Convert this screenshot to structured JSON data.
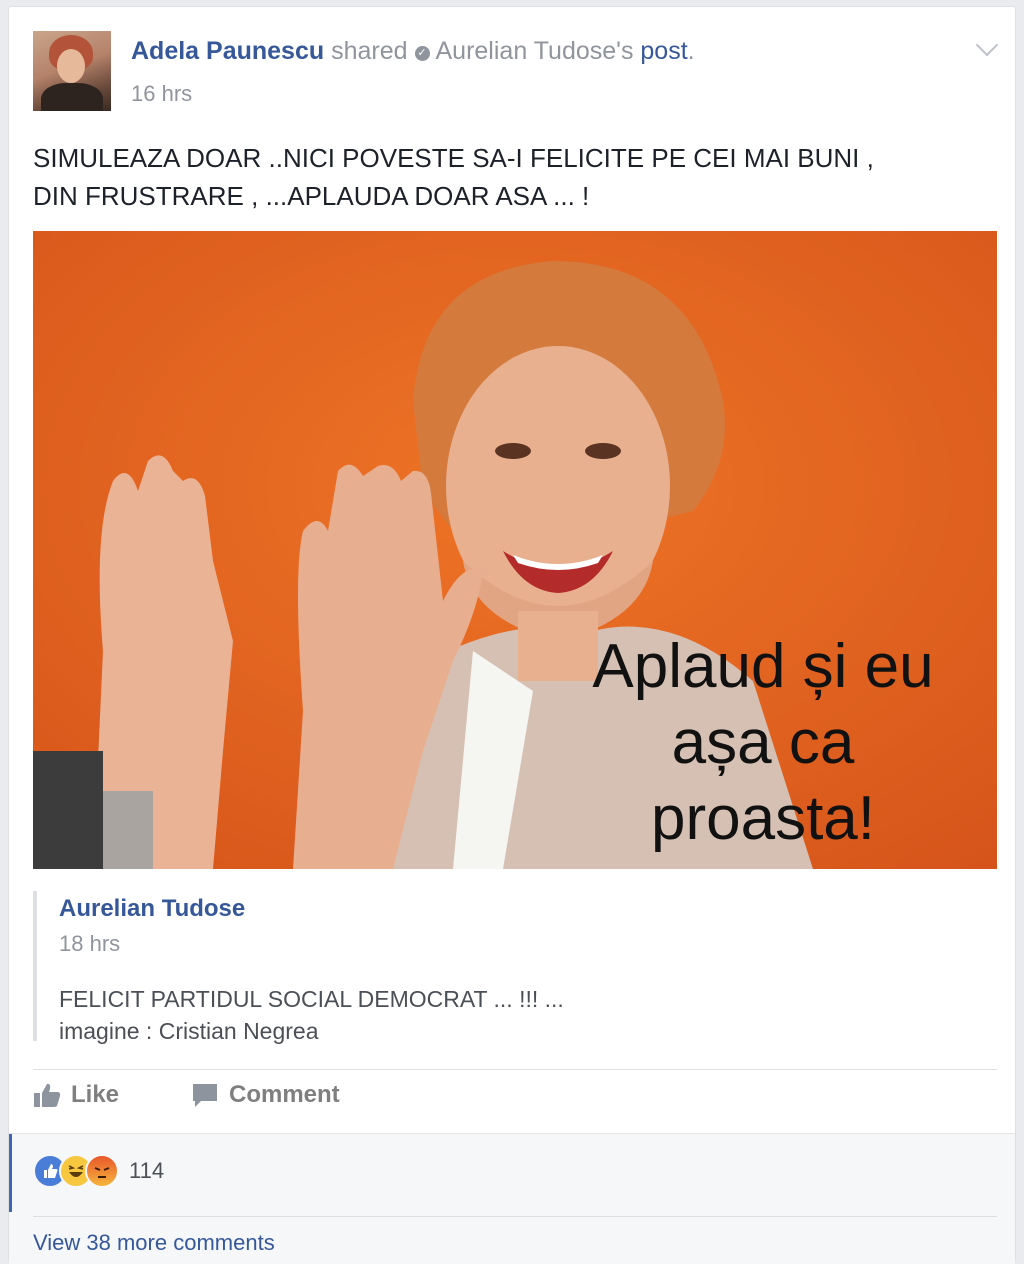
{
  "post": {
    "author": "Adela Paunescu",
    "shared_word": "shared",
    "shared_from": "Aurelian Tudose's",
    "post_word": "post",
    "time": "16 hrs",
    "text_line1": "SIMULEAZA DOAR ..NICI POVESTE SA-I FELICITE PE CEI MAI BUNI ,",
    "text_line2": "DIN FRUSTRARE , ...APLAUDA DOAR ASA ... !"
  },
  "image": {
    "caption_line1": "Aplaud și eu",
    "caption_line2": "așa ca",
    "caption_line3": "proasta!"
  },
  "original": {
    "author": "Aurelian Tudose",
    "time": "18 hrs",
    "text_line1": "FELICIT PARTIDUL SOCIAL DEMOCRAT ... !!! ...",
    "text_line2": "imagine : Cristian Negrea"
  },
  "actions": {
    "like": "Like",
    "comment": "Comment"
  },
  "reactions": {
    "count": "114",
    "icons": [
      "like-reaction",
      "haha-reaction",
      "angry-reaction"
    ]
  },
  "comments": {
    "view_more": "View 38 more comments"
  },
  "colors": {
    "link": "#365899",
    "muted": "#90949c",
    "photo_bg": "#e6641f"
  }
}
